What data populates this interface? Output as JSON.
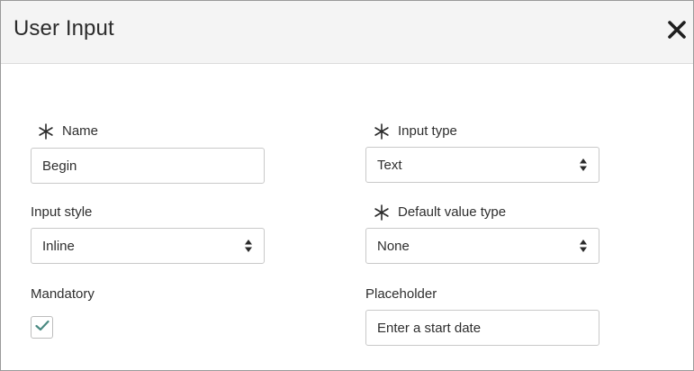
{
  "dialog": {
    "title": "User Input",
    "close_icon": "close-x-icon"
  },
  "form": {
    "name": {
      "label": "Name",
      "required": true,
      "value": "Begin"
    },
    "input_type": {
      "label": "Input type",
      "required": true,
      "selected": "Text"
    },
    "input_style": {
      "label": "Input style",
      "required": false,
      "selected": "Inline"
    },
    "default_value_type": {
      "label": "Default value type",
      "required": true,
      "selected": "None"
    },
    "mandatory": {
      "label": "Mandatory",
      "checked": true
    },
    "placeholder": {
      "label": "Placeholder",
      "value": "Enter a start date"
    }
  },
  "colors": {
    "header_bg": "#f4f4f4",
    "check_color": "#4a8a82",
    "border": "#c9c9c9"
  }
}
